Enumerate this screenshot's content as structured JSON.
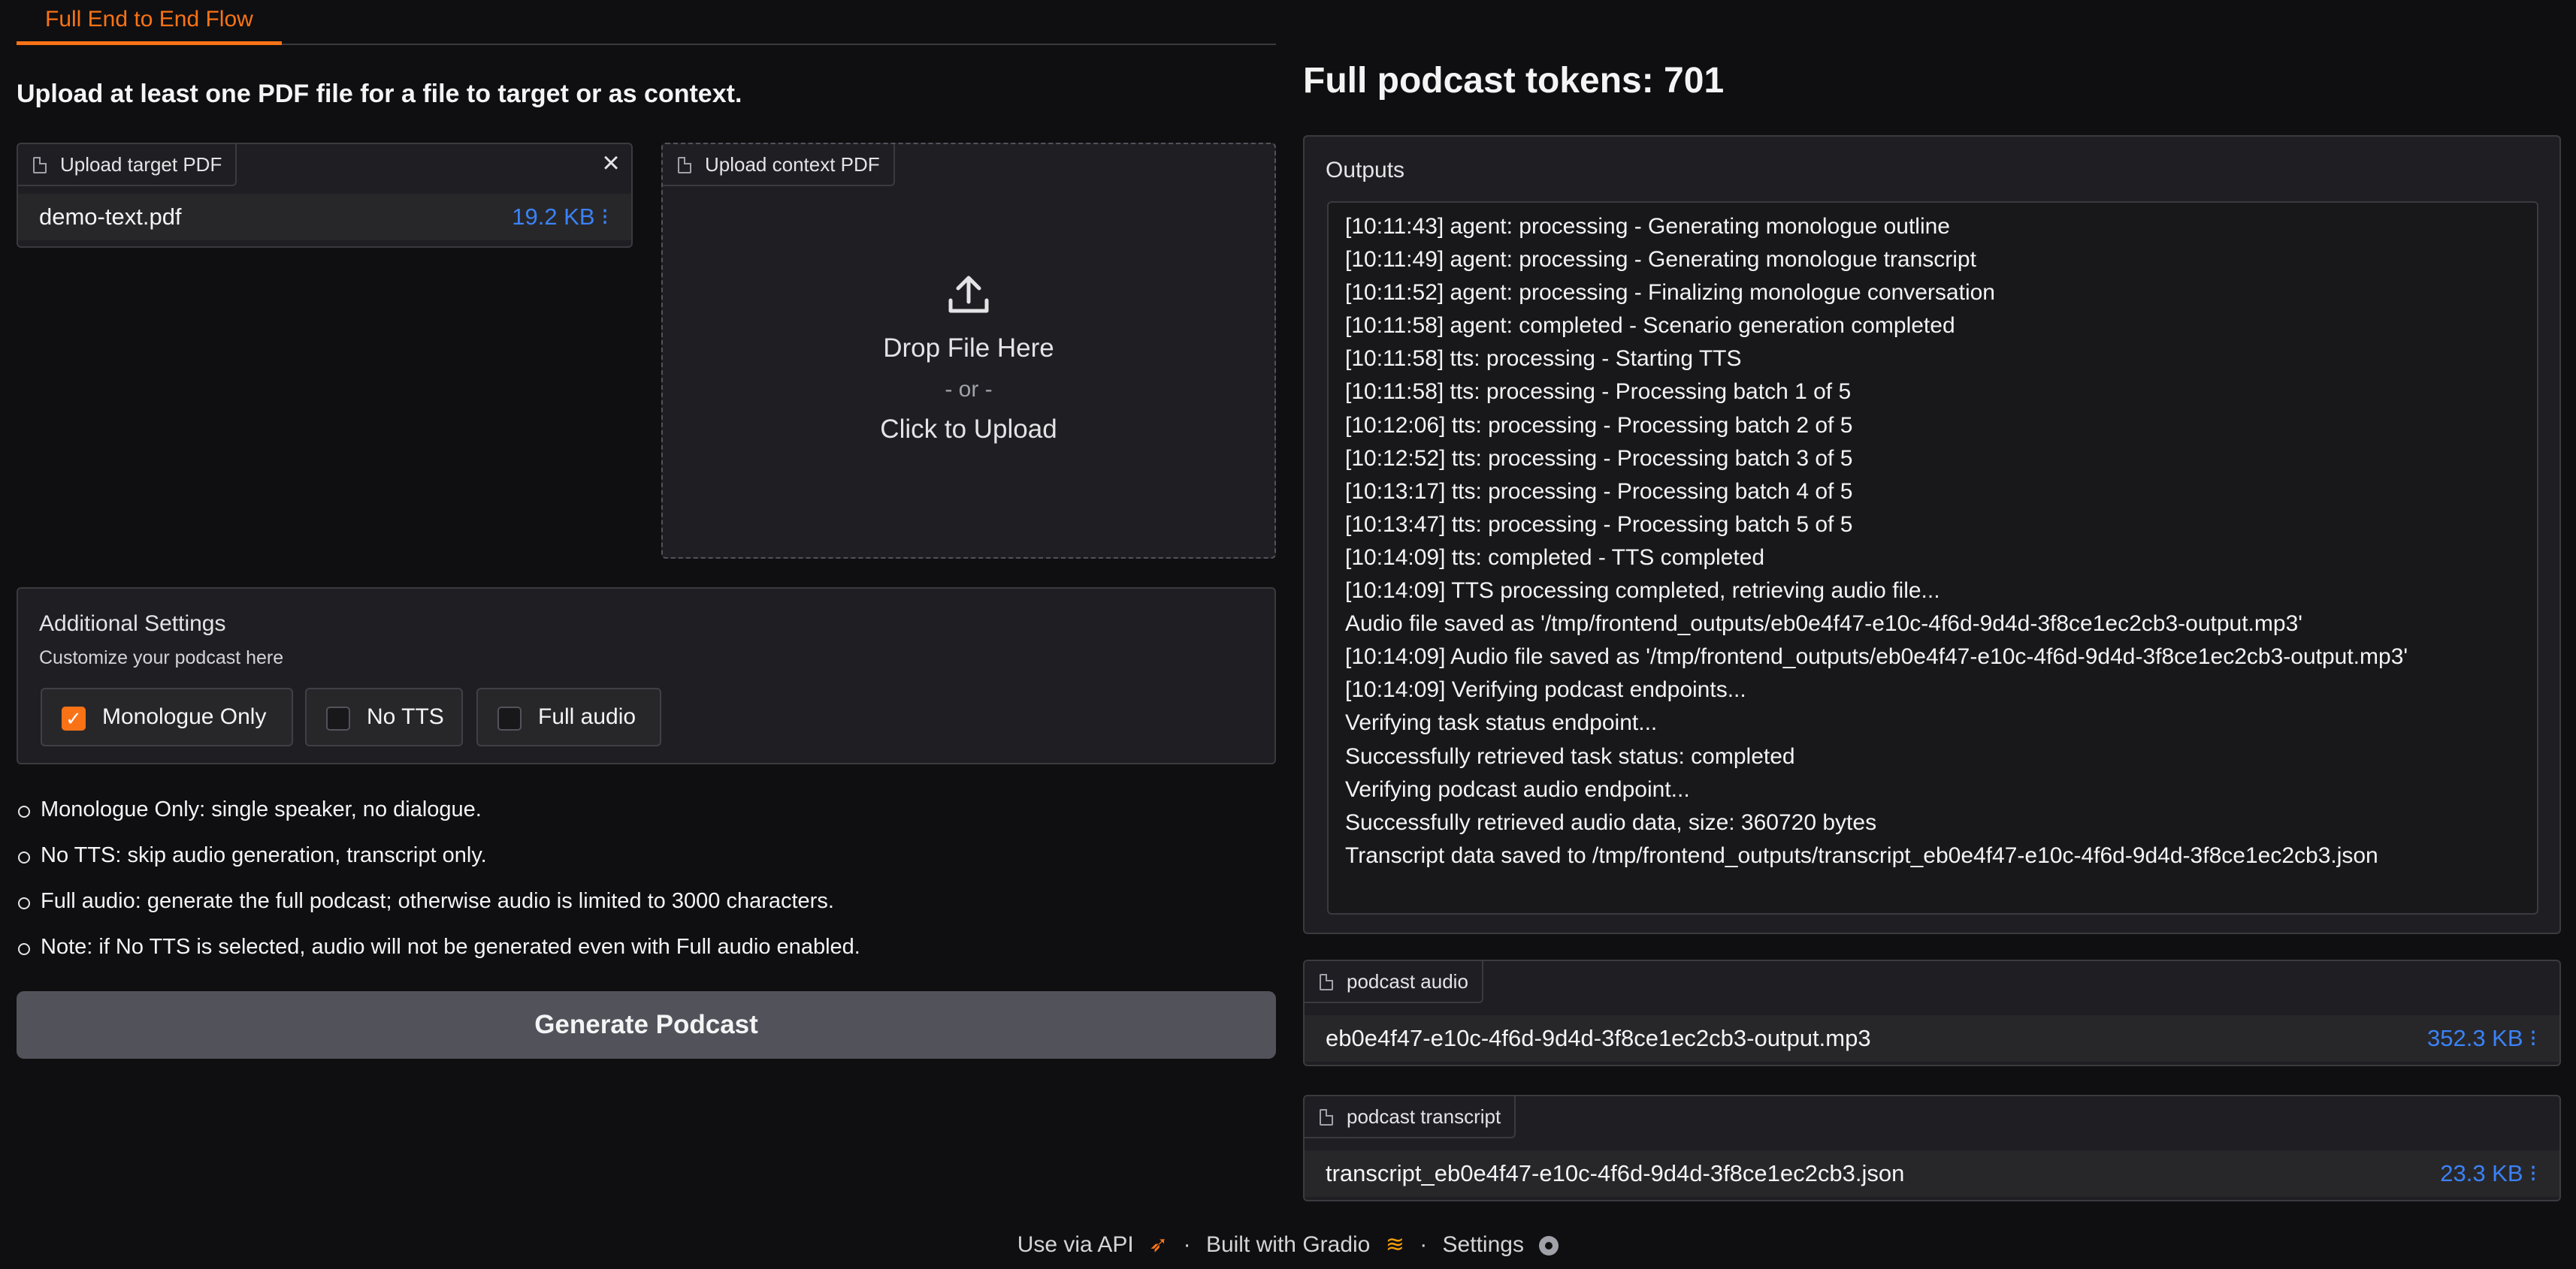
{
  "tabs": [
    {
      "label": "Full End to End Flow"
    }
  ],
  "instruction": "Upload at least one PDF file for a file to target or as context.",
  "target_pdf": {
    "label": "Upload target PDF",
    "filename": "demo-text.pdf",
    "size": "19.2 KB ⁝",
    "close": "×"
  },
  "context_pdf": {
    "label": "Upload context PDF",
    "drop_text": "Drop File Here",
    "or_text": "- or -",
    "click_text": "Click to Upload"
  },
  "settings": {
    "title": "Additional Settings",
    "subtitle": "Customize your podcast here",
    "options": [
      {
        "label": "Monologue Only",
        "checked": true
      },
      {
        "label": "No TTS",
        "checked": false
      },
      {
        "label": "Full audio",
        "checked": false
      }
    ]
  },
  "notes": [
    "Monologue Only: single speaker, no dialogue.",
    "No TTS: skip audio generation, transcript only.",
    "Full audio: generate the full podcast; otherwise audio is limited to 3000 characters.",
    "Note: if No TTS is selected, audio will not be generated even with Full audio enabled."
  ],
  "generate_button": "Generate Podcast",
  "tokens_heading": "Full podcast tokens: 701",
  "outputs": {
    "label": "Outputs",
    "lines": [
      "[10:11:43] agent: processing - Generating monologue outline",
      "[10:11:49] agent: processing - Generating monologue transcript",
      "[10:11:52] agent: processing - Finalizing monologue conversation",
      "[10:11:58] agent: completed - Scenario generation completed",
      "[10:11:58] tts: processing - Starting TTS",
      "[10:11:58] tts: processing - Processing batch 1 of 5",
      "[10:12:06] tts: processing - Processing batch 2 of 5",
      "[10:12:52] tts: processing - Processing batch 3 of 5",
      "[10:13:17] tts: processing - Processing batch 4 of 5",
      "[10:13:47] tts: processing - Processing batch 5 of 5",
      "[10:14:09] tts: completed - TTS completed",
      "[10:14:09] TTS processing completed, retrieving audio file...",
      "Audio file saved as '/tmp/frontend_outputs/eb0e4f47-e10c-4f6d-9d4d-3f8ce1ec2cb3-output.mp3'",
      "[10:14:09] Audio file saved as '/tmp/frontend_outputs/eb0e4f47-e10c-4f6d-9d4d-3f8ce1ec2cb3-output.mp3'",
      "[10:14:09] Verifying podcast endpoints...",
      "Verifying task status endpoint...",
      "Successfully retrieved task status: completed",
      "Verifying podcast audio endpoint...",
      "Successfully retrieved audio data, size: 360720 bytes",
      "Transcript data saved to /tmp/frontend_outputs/transcript_eb0e4f47-e10c-4f6d-9d4d-3f8ce1ec2cb3.json"
    ]
  },
  "podcast_audio": {
    "label": "podcast audio",
    "filename": "eb0e4f47-e10c-4f6d-9d4d-3f8ce1ec2cb3-output.mp3",
    "size": "352.3 KB ⁝"
  },
  "podcast_transcript": {
    "label": "podcast transcript",
    "filename": "transcript_eb0e4f47-e10c-4f6d-9d4d-3f8ce1ec2cb3.json",
    "size": "23.3 KB ⁝"
  },
  "footer": {
    "api": "Use via API",
    "built": "Built with Gradio",
    "settings": "Settings",
    "sep": "·"
  },
  "colors": {
    "accent": "#f97316",
    "link": "#3b82f6",
    "background": "#0f0f11"
  }
}
